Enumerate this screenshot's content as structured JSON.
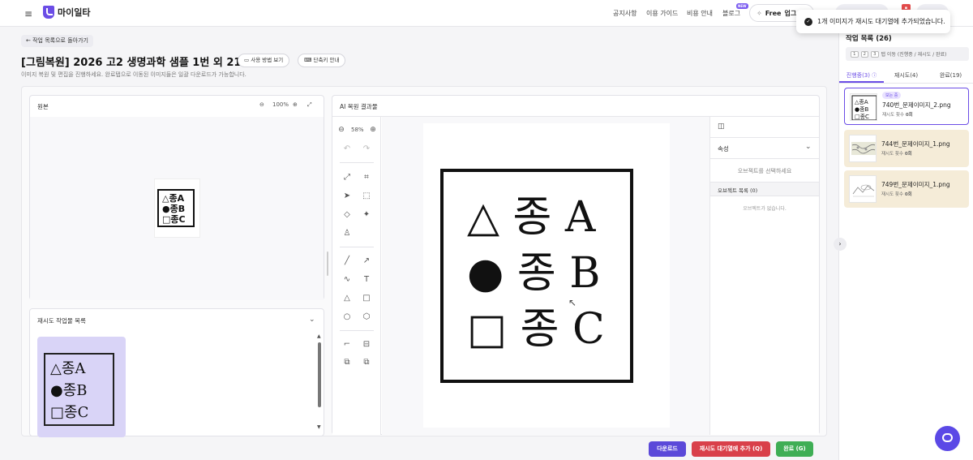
{
  "topbar": {
    "app_name": "마이일타",
    "nav": [
      "공지사항",
      "이용 가이드",
      "비용 안내",
      "블로그"
    ],
    "new_badge": "NEW",
    "plan_label": "Free",
    "upgrade_label": "업그"
  },
  "toast": {
    "message": "1개 이미지가 재시도 대기열에 추가되었습니다."
  },
  "header": {
    "back_label": "작업 목록으로 돌아가기",
    "title": "[그림복원] 2026 고2 생명과학 샘플 1번 외 21개",
    "usage_btn": "사용 방법 보기",
    "shortcut_btn": "단축키 안내",
    "subtitle": "이미지 복원 및 편집을 진행하세요. 완료탭으로 이동된 이미지들은 일괄 다운로드가 가능합니다."
  },
  "original": {
    "title": "원본",
    "zoom": "100%"
  },
  "retry_list": {
    "title": "재시도 작업물 목록"
  },
  "result": {
    "title": "AI 복원 결과물",
    "zoom": "58%",
    "rows": [
      {
        "symbol": "△",
        "text": "종 A"
      },
      {
        "symbol": "●",
        "text": "종 B"
      },
      {
        "symbol": "□",
        "text": "종 C"
      }
    ]
  },
  "properties": {
    "title": "속성",
    "select_hint": "오브젝트를 선택하세요",
    "object_list_title": "오브젝트 목록 (0)",
    "no_objects": "오브젝트가 없습니다."
  },
  "footer": {
    "download": "다운로드",
    "retry_queue": "재시도 대기열에 추가 (Q)",
    "complete": "완료 (G)"
  },
  "sidebar": {
    "title": "작업 목록 (26)",
    "key_hint_keys": [
      "1",
      "2",
      "3"
    ],
    "key_hint_text": "탭 이동 (진행중 / 재시도 / 완료)",
    "tabs": [
      "진행중(3)",
      "재시도(4)",
      "완료(19)"
    ],
    "cards": [
      {
        "badge": "보는 중",
        "name": "740번_문제이미지_2.png",
        "meta_label": "재시도 횟수",
        "meta_value": "0회"
      },
      {
        "name": "744번_문제이미지_1.png",
        "meta_label": "재시도 횟수",
        "meta_value": "0회"
      },
      {
        "name": "749번_문제이미지_1.png",
        "meta_label": "재시도 횟수",
        "meta_value": "0회"
      }
    ]
  },
  "colors": {
    "accent": "#6b4de6",
    "retry_red": "#d9404a",
    "complete_green": "#3fae55",
    "card_warm": "#f5ecd8"
  }
}
